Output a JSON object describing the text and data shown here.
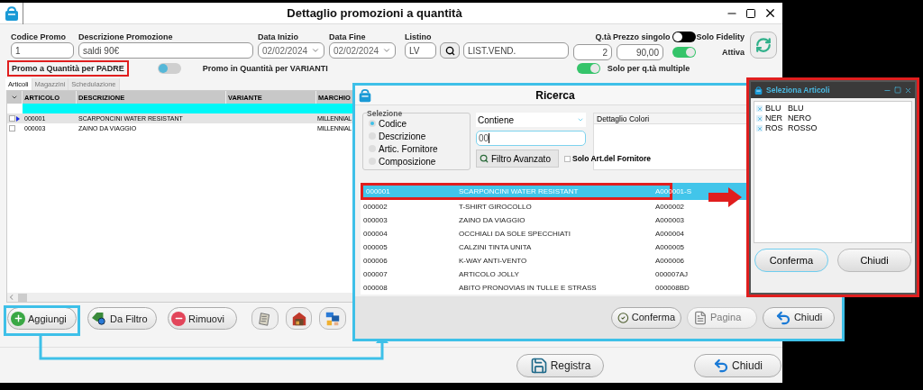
{
  "window": {
    "title": "Dettaglio promozioni a quantità"
  },
  "fields": [
    {
      "kind": "text",
      "label": "Codice Promo",
      "value": "1"
    },
    {
      "kind": "text",
      "label": "Descrizione Promozione",
      "value": "saldi 90€"
    },
    {
      "kind": "date",
      "label": "Data Inizio",
      "value": "02/02/2024"
    },
    {
      "kind": "date",
      "label": "Data Fine",
      "value": "02/02/2024"
    },
    {
      "kind": "lookup",
      "label": "Listino",
      "value": "LV",
      "description": "LIST.VEND."
    }
  ],
  "quantity": {
    "label": "Q.tà",
    "value": "2"
  },
  "price": {
    "label": "Prezzo singolo",
    "value": "90,00"
  },
  "fidelity": {
    "label": "Solo Fidelity",
    "on": false
  },
  "active": {
    "label": "Attiva",
    "on": true
  },
  "multiples": {
    "label": "Solo per q.tà multiple",
    "on": true
  },
  "mode": {
    "left_label": "Promo a Quantità per PADRE",
    "right_label": "Promo in Quantità per VARIANTI",
    "on": false
  },
  "tabs": [
    {
      "label": "Articoli",
      "selected": true
    },
    {
      "label": "Magazzini",
      "selected": false
    },
    {
      "label": "Schedulazione",
      "selected": false
    }
  ],
  "table": {
    "columns": [
      "ARTICOLO",
      "DESCRIZIONE",
      "VARIANTE",
      "MARCHIO"
    ],
    "rows": [
      {
        "code": "000001",
        "description": "SCARPONCINI WATER RESISTANT",
        "brand": "MILLENNIAL",
        "selected": true,
        "checked": false
      },
      {
        "code": "000003",
        "description": "ZAINO DA VIAGGIO",
        "brand": "MILLENNIAL",
        "selected": false,
        "checked": false
      }
    ]
  },
  "actions": [
    {
      "kind": "add",
      "label": "Aggiungi"
    },
    {
      "kind": "filter",
      "label": "Da Filtro"
    },
    {
      "kind": "remove",
      "label": "Rimuovi"
    },
    {
      "kind": "document"
    },
    {
      "kind": "warehouse"
    },
    {
      "kind": "machine"
    }
  ],
  "footer": [
    {
      "kind": "save",
      "label": "Registra"
    },
    {
      "kind": "close",
      "label": "Chiudi"
    }
  ],
  "search_dialog": {
    "title": "Ricerca",
    "group_title": "Selezione",
    "options": [
      {
        "label": "Codice",
        "selected": true
      },
      {
        "label": "Descrizione",
        "selected": false
      },
      {
        "label": "Artic. Fornitore",
        "selected": false
      },
      {
        "label": "Composizione",
        "selected": false
      }
    ],
    "match": "Contiene",
    "query": "00",
    "filter_button": "Filtro Avanzato",
    "supplier_only": {
      "label": "Solo Art.del Fornitore",
      "checked": false
    },
    "detail_title": "Dettaglio Colori",
    "results": [
      {
        "code": "000001",
        "description": "SCARPONCINI WATER RESISTANT",
        "supplier_code": "A000001-S",
        "selected": true
      },
      {
        "code": "000002",
        "description": "T-SHIRT GIROCOLLO",
        "supplier_code": "A000002",
        "selected": false
      },
      {
        "code": "000003",
        "description": "ZAINO DA VIAGGIO",
        "supplier_code": "A000003",
        "selected": false
      },
      {
        "code": "000004",
        "description": "OCCHIALI DA SOLE SPECCHIATI",
        "supplier_code": "A000004",
        "selected": false
      },
      {
        "code": "000005",
        "description": "CALZINI TINTA UNITA",
        "supplier_code": "A000005",
        "selected": false
      },
      {
        "code": "000006",
        "description": "K-WAY ANTI-VENTO",
        "supplier_code": "A000006",
        "selected": false
      },
      {
        "code": "000007",
        "description": "ARTICOLO JOLLY",
        "supplier_code": "000007AJ",
        "selected": false
      },
      {
        "code": "000008",
        "description": "ABITO PRONOVIAS IN TULLE E STRASS",
        "supplier_code": "000008BD",
        "selected": false
      }
    ],
    "buttons": [
      {
        "kind": "confirm",
        "label": "Conferma",
        "disabled": false
      },
      {
        "kind": "page",
        "label": "Pagina",
        "disabled": true
      },
      {
        "kind": "close",
        "label": "Chiudi",
        "disabled": false
      }
    ]
  },
  "selector": {
    "title": "Seleziona Articoli",
    "items": [
      {
        "code": "BLU",
        "name": "BLU",
        "checked": true
      },
      {
        "code": "NER",
        "name": "NERO",
        "checked": true
      },
      {
        "code": "ROS",
        "name": "ROSSO",
        "checked": true
      }
    ],
    "buttons": [
      "Conferma",
      "Chiudi"
    ]
  }
}
